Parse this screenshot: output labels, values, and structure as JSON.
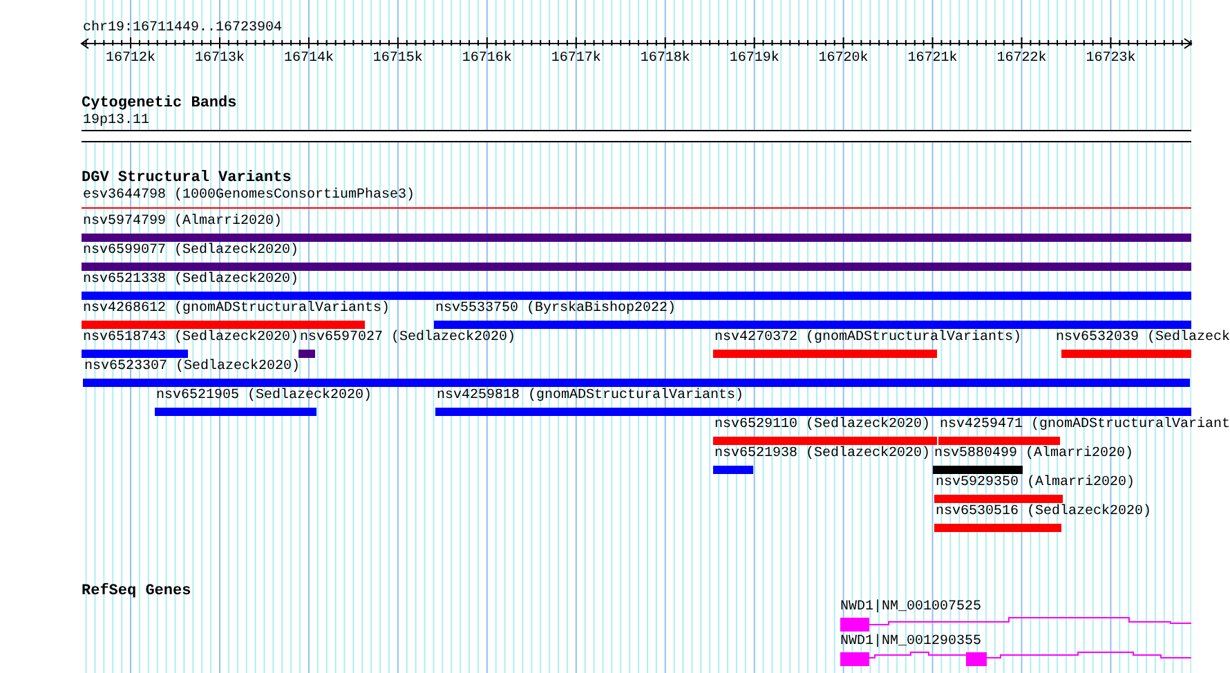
{
  "ruler": {
    "location": "chr19:16711449..16723904",
    "ticks": [
      "16712k",
      "16713k",
      "16714k",
      "16715k",
      "16716k",
      "16717k",
      "16718k",
      "16719k",
      "16720k",
      "16721k",
      "16722k",
      "16723k"
    ]
  },
  "tracks": [
    {
      "kind": "bands",
      "title": "Cytogenetic Bands",
      "bands": [
        {
          "label": "19p13.11"
        }
      ]
    },
    {
      "kind": "variants",
      "title": "DGV Structural Variants",
      "rows": [
        {
          "features": [
            {
              "kind": "line",
              "label": "esv3644798 (1000GenomesConsortiumPhase3)",
              "color": "#ff0000"
            }
          ]
        },
        {
          "features": [
            {
              "kind": "bar",
              "label": "nsv5974799 (Almarri2020)",
              "color": "#4b0082"
            }
          ]
        },
        {
          "features": [
            {
              "kind": "bar",
              "label": "nsv6599077 (Sedlazeck2020)",
              "color": "#4b0082"
            }
          ]
        },
        {
          "features": [
            {
              "kind": "bar",
              "label": "nsv6521338 (Sedlazeck2020)",
              "color": "#0000ff"
            }
          ]
        },
        {
          "features": [
            {
              "kind": "bar",
              "label": "nsv4268612 (gnomADStructuralVariants)",
              "color": "#ff0000"
            },
            {
              "kind": "bar",
              "label": "nsv5533750 (ByrskaBishop2022)",
              "color": "#0000ff"
            }
          ]
        },
        {
          "features": [
            {
              "kind": "bar",
              "label": "nsv6518743 (Sedlazeck2020)",
              "color": "#0000ff"
            },
            {
              "kind": "bar",
              "label": "nsv6597027 (Sedlazeck2020)",
              "color": "#4b0082"
            },
            {
              "kind": "bar",
              "label": "nsv4270372 (gnomADStructuralVariants)",
              "color": "#ff0000"
            },
            {
              "kind": "bar",
              "label": "nsv6532039 (Sedlazeck",
              "color": "#ff0000"
            }
          ]
        },
        {
          "features": [
            {
              "kind": "bar",
              "label": "nsv6523307 (Sedlazeck2020)",
              "color": "#0000ff"
            }
          ]
        },
        {
          "features": [
            {
              "kind": "bar",
              "label": "nsv6521905 (Sedlazeck2020)",
              "color": "#0000ff"
            },
            {
              "kind": "bar",
              "label": "nsv4259818 (gnomADStructuralVariants)",
              "color": "#0000ff"
            }
          ]
        },
        {
          "features": [
            {
              "kind": "bar",
              "label": "nsv6529110 (Sedlazeck2020)",
              "color": "#ff0000"
            },
            {
              "kind": "bar",
              "label": "nsv4259471 (gnomADStructuralVariant",
              "color": "#ff0000"
            }
          ]
        },
        {
          "features": [
            {
              "kind": "bar",
              "label": "nsv6521938 (Sedlazeck2020)",
              "color": "#0000ff"
            },
            {
              "kind": "bar",
              "label": "nsv5880499 (Almarri2020)",
              "color": "#000000"
            }
          ]
        },
        {
          "features": [
            {
              "kind": "bar",
              "label": "nsv5929350 (Almarri2020)",
              "color": "#ff0000"
            }
          ]
        },
        {
          "features": [
            {
              "kind": "bar",
              "label": "nsv6530516 (Sedlazeck2020)",
              "color": "#ff0000"
            }
          ]
        }
      ]
    },
    {
      "kind": "genes",
      "title": "RefSeq Genes",
      "transcripts": [
        {
          "label": "NWD1|NM_001007525"
        },
        {
          "label": "NWD1|NM_001290355"
        }
      ]
    }
  ]
}
